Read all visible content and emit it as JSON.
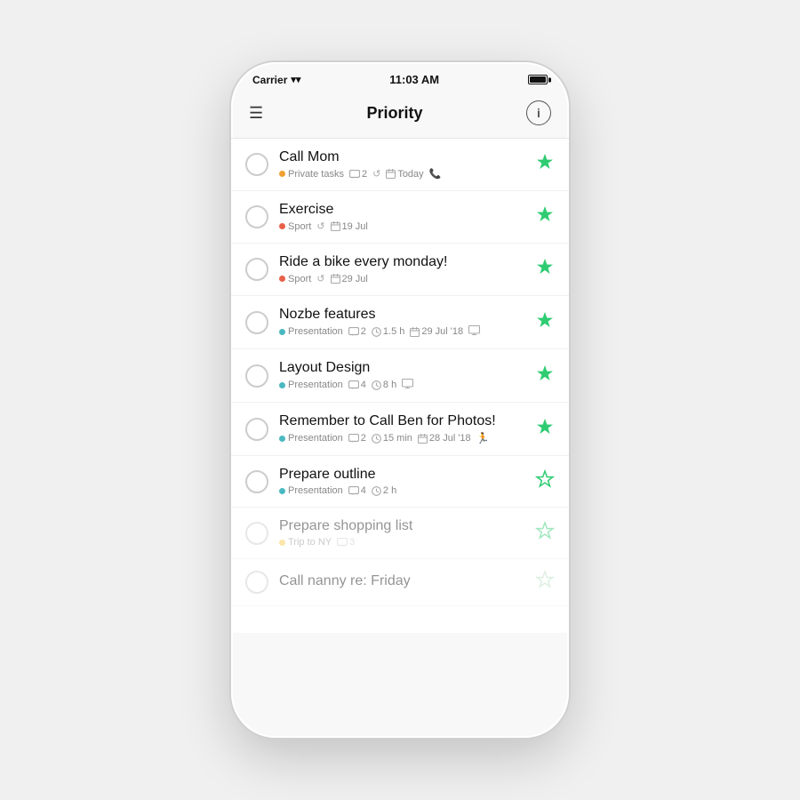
{
  "statusBar": {
    "carrier": "Carrier",
    "time": "11:03 AM"
  },
  "navBar": {
    "title": "Priority",
    "infoLabel": "i"
  },
  "tasks": [
    {
      "id": 1,
      "title": "Call Mom",
      "tag": "Private tasks",
      "tagColor": "orange",
      "meta": [
        "💬 2",
        "↺",
        "📅 Today",
        "📞"
      ],
      "metaText": [
        "2",
        "↺",
        "Today",
        "📞"
      ],
      "starState": "filled",
      "faded": false
    },
    {
      "id": 2,
      "title": "Exercise",
      "tag": "Sport",
      "tagColor": "coral",
      "meta": [
        "↺",
        "📅 19 Jul"
      ],
      "metaText": [
        "↺",
        "19 Jul"
      ],
      "starState": "filled",
      "faded": false
    },
    {
      "id": 3,
      "title": "Ride a bike every monday!",
      "tag": "Sport",
      "tagColor": "coral",
      "meta": [
        "↺",
        "📅 29 Jul"
      ],
      "metaText": [
        "↺",
        "29 Jul"
      ],
      "starState": "filled",
      "faded": false
    },
    {
      "id": 4,
      "title": "Nozbe features",
      "tag": "Presentation",
      "tagColor": "teal",
      "meta": [
        "💬 2",
        "⏱ 1.5 h",
        "📅 29 Jul '18",
        "🖥"
      ],
      "metaText": [
        "2",
        "1.5 h",
        "29 Jul '18",
        "🖥"
      ],
      "starState": "filled",
      "faded": false
    },
    {
      "id": 5,
      "title": "Layout Design",
      "tag": "Presentation",
      "tagColor": "teal",
      "meta": [
        "💬 4",
        "⏱ 8 h",
        "🖥"
      ],
      "metaText": [
        "4",
        "8 h",
        "🖥"
      ],
      "starState": "filled",
      "faded": false
    },
    {
      "id": 6,
      "title": "Remember to Call Ben for Photos!",
      "tag": "Presentation",
      "tagColor": "teal",
      "meta": [
        "💬 2",
        "⏱ 15 min",
        "📅 28 Jul '18",
        "🏃"
      ],
      "metaText": [
        "2",
        "15 min",
        "28 Jul '18",
        "🏃"
      ],
      "starState": "filled",
      "faded": false
    },
    {
      "id": 7,
      "title": "Prepare outline",
      "tag": "Presentation",
      "tagColor": "teal",
      "meta": [
        "💬 4",
        "⏱ 2 h"
      ],
      "metaText": [
        "4",
        "2 h"
      ],
      "starState": "outline",
      "faded": false
    },
    {
      "id": 8,
      "title": "Prepare shopping list",
      "tag": "Trip to NY",
      "tagColor": "yellow",
      "meta": [
        "💬 3"
      ],
      "metaText": [
        "3"
      ],
      "starState": "outline",
      "faded": true
    },
    {
      "id": 9,
      "title": "Call nanny re: Friday",
      "tag": "",
      "tagColor": "",
      "meta": [],
      "metaText": [],
      "starState": "faint",
      "faded": true
    }
  ]
}
